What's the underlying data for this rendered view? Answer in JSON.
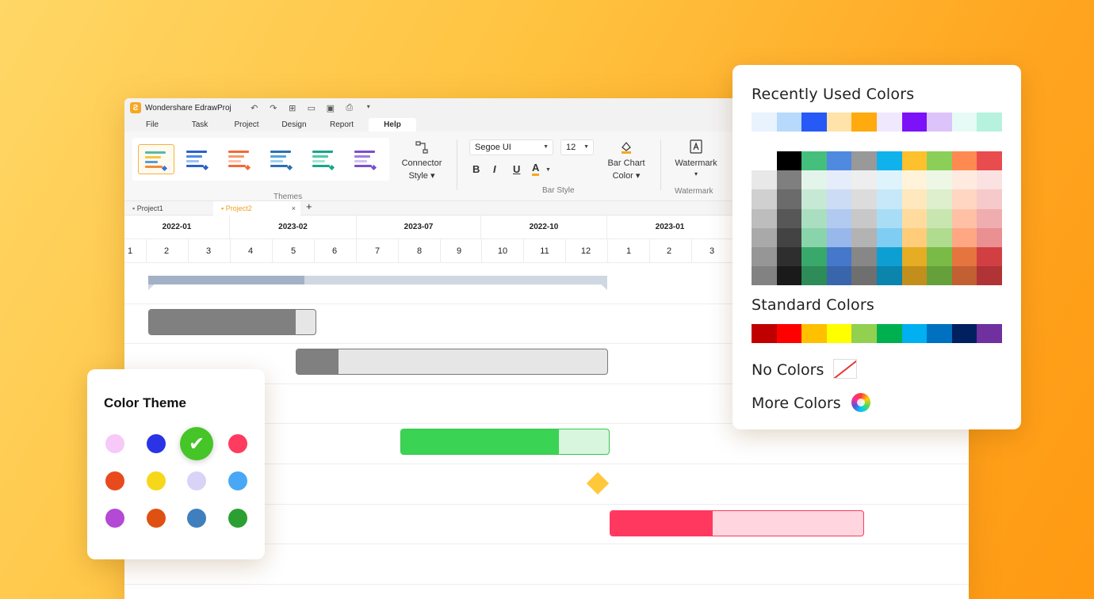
{
  "app": {
    "title": "Wondershare EdrawProj",
    "logo_glyph": "Ƨ",
    "menu": [
      "File",
      "Task",
      "Project",
      "Design",
      "Report",
      "Help"
    ],
    "active_menu": "Help"
  },
  "ribbon": {
    "themes_label": "Themes",
    "connector_style": {
      "line1": "Connector",
      "line2": "Style ▾"
    },
    "font_name": "Segoe UI",
    "font_size": "12",
    "bar_style_label": "Bar Style",
    "bar_chart_color": {
      "line1": "Bar Chart",
      "line2": "Color ▾"
    },
    "watermark": {
      "line1": "Watermark",
      "caret": "▾"
    },
    "watermark_group_label": "Watermark",
    "format_buttons": {
      "bold": "B",
      "italic": "I",
      "underline": "U",
      "font_color": "A"
    },
    "themes": [
      {
        "colors": [
          "#5ab8a8",
          "#f5c842",
          "#5b9bd5",
          "#f08c3a"
        ],
        "marker": "#3a6fd8",
        "selected": true
      },
      {
        "colors": [
          "#2a62c9",
          "#4e8ae8",
          "#9cc1f5",
          "#2a62c9"
        ],
        "marker": "#2a62c9",
        "selected": false
      },
      {
        "colors": [
          "#f2693a",
          "#f59a6a",
          "#fbc4a6",
          "#f2693a"
        ],
        "marker": "#f2693a",
        "selected": false
      },
      {
        "colors": [
          "#2f6fb3",
          "#4fa3e0",
          "#9fd0f2",
          "#2f6fb3"
        ],
        "marker": "#2f6fb3",
        "selected": false
      },
      {
        "colors": [
          "#1aa58a",
          "#4cc9a9",
          "#a3e6d3",
          "#1aa58a"
        ],
        "marker": "#1aa58a",
        "selected": false
      },
      {
        "colors": [
          "#7b4fc9",
          "#a07ee3",
          "#d2c1f3",
          "#7b4fc9"
        ],
        "marker": "#7b4fc9",
        "selected": false
      }
    ]
  },
  "doc_tabs": [
    {
      "label": "Project1",
      "active": false
    },
    {
      "label": "Project2",
      "active": true
    }
  ],
  "gantt": {
    "periods": [
      "2022-01",
      "2023-02",
      "2023-07",
      "2022-10",
      "2023-01"
    ],
    "months": [
      "1",
      "2",
      "3",
      "4",
      "5",
      "6",
      "7",
      "8",
      "9",
      "10",
      "11",
      "12",
      "1",
      "2",
      "3"
    ],
    "tasks": [
      {
        "type": "summary",
        "color": "#cfd7e2",
        "fill_color": "#a2b1c5",
        "progress": 0.34
      },
      {
        "type": "bar",
        "color": "#e6e6e6",
        "fill_color": "#808080",
        "border": "#7a7a7a",
        "progress": 0.88
      },
      {
        "type": "bar",
        "color": "#e6e6e6",
        "fill_color": "#808080",
        "border": "#7a7a7a",
        "progress": 0.135
      },
      {
        "type": "bar",
        "color": "#d8f6dd",
        "fill_color": "#3ad354",
        "border": "#37c84f",
        "progress": 0.76
      },
      {
        "type": "milestone",
        "color": "#ffc83a"
      },
      {
        "type": "bar",
        "color": "#ffd6df",
        "fill_color": "#ff385f",
        "border": "#ff385f",
        "progress": 0.405
      }
    ]
  },
  "color_picker": {
    "recent_title": "Recently Used Colors",
    "recent": [
      "#e8f3fe",
      "#b7d9fb",
      "#2659f5",
      "#ffe3a8",
      "#ffaa0e",
      "#f0e9fe",
      "#7b12f7",
      "#dcc4fb",
      "#e6fbf5",
      "#b6f2de"
    ],
    "grid": [
      [
        "#ffffff",
        "#000000",
        "#44c07c",
        "#4f8ae0",
        "#999999",
        "#0fb2eb",
        "#fcc12c",
        "#8ccf58",
        "#ff8a51",
        "#e84c4f"
      ],
      [
        "#e8e8e8",
        "#7f7f7f",
        "#e3f4ea",
        "#e5edfa",
        "#eeeeee",
        "#dff3fc",
        "#fff3da",
        "#eef7e6",
        "#ffeadf",
        "#fbe2e2"
      ],
      [
        "#d0d0d0",
        "#6b6b6b",
        "#c5e9d4",
        "#ccdcf5",
        "#dcdcdc",
        "#c6e8f9",
        "#ffe8bd",
        "#ddefcc",
        "#ffd6c2",
        "#f6c9ca"
      ],
      [
        "#bdbdbd",
        "#575757",
        "#a9dfc0",
        "#b2caf0",
        "#c8c8c8",
        "#a9ddf6",
        "#ffdb9e",
        "#c9e6b1",
        "#ffc0a6",
        "#f0adaf"
      ],
      [
        "#a9a9a9",
        "#434343",
        "#8ad4ab",
        "#98b8eb",
        "#b3b3b3",
        "#7fcdf3",
        "#ffcd7a",
        "#b0dc8f",
        "#ffa783",
        "#ea8f92"
      ],
      [
        "#969696",
        "#2e2e2e",
        "#38a96a",
        "#4577cb",
        "#878787",
        "#0e9fd2",
        "#e5ad24",
        "#7aba47",
        "#e6743f",
        "#d13f43"
      ],
      [
        "#828282",
        "#1a1a1a",
        "#2d8c58",
        "#3965ac",
        "#6f6f6f",
        "#0b84ae",
        "#c28f1d",
        "#66a03b",
        "#c25f33",
        "#b03336"
      ]
    ],
    "standard_title": "Standard Colors",
    "standard": [
      "#c00000",
      "#ff0000",
      "#ffc000",
      "#ffff00",
      "#92d050",
      "#00b050",
      "#00b0f0",
      "#0070c0",
      "#002060",
      "#7030a0"
    ],
    "no_colors_label": "No Colors",
    "more_colors_label": "More Colors"
  },
  "color_theme": {
    "title": "Color Theme",
    "check_glyph": "✔",
    "colors": [
      "#f6c9f8",
      "#2a33e6",
      "#45c527",
      "#ff3b5f",
      "#e84a1e",
      "#f7d71a",
      "#d9d3f8",
      "#48a8f5",
      "#b349d4",
      "#df5112",
      "#3f7fbd",
      "#2c9f33"
    ],
    "selected_index": 2
  }
}
